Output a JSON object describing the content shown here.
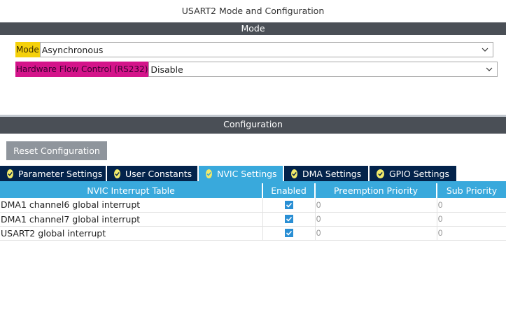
{
  "window": {
    "title": "USART2 Mode and Configuration"
  },
  "mode_section": {
    "header": "Mode",
    "mode": {
      "label": "Mode",
      "value": "Asynchronous"
    },
    "hw_flow": {
      "label": "Hardware Flow Control (RS232)",
      "value": "Disable"
    }
  },
  "config_section": {
    "header": "Configuration",
    "reset_label": "Reset Configuration",
    "tabs": [
      {
        "label": "Parameter Settings"
      },
      {
        "label": "User Constants"
      },
      {
        "label": "NVIC Settings"
      },
      {
        "label": "DMA Settings"
      },
      {
        "label": "GPIO Settings"
      }
    ],
    "active_tab": "NVIC Settings"
  },
  "nvic_table": {
    "columns": [
      "NVIC Interrupt Table",
      "Enabled",
      "Preemption Priority",
      "Sub Priority"
    ],
    "rows": [
      {
        "name": "DMA1 channel6 global interrupt",
        "enabled": true,
        "preemption": "0",
        "sub": "0"
      },
      {
        "name": "DMA1 channel7 global interrupt",
        "enabled": true,
        "preemption": "0",
        "sub": "0"
      },
      {
        "name": "USART2 global interrupt",
        "enabled": true,
        "preemption": "0",
        "sub": "0"
      }
    ]
  },
  "colors": {
    "header_bar": "#4a4f56",
    "tab_inactive": "#03234b",
    "tab_active": "#39a9dc",
    "mode_highlight": "#f5d10a",
    "hw_highlight": "#d4148a",
    "checkbox": "#2a8fd4"
  }
}
